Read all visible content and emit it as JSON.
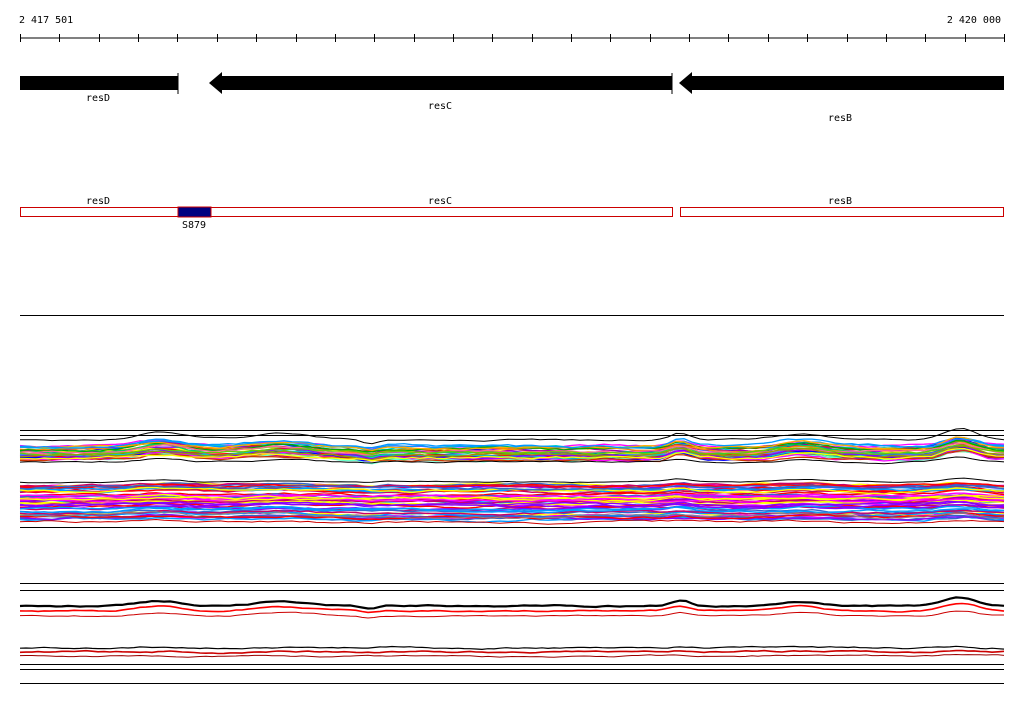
{
  "ruler": {
    "start_label": "2 417 501",
    "end_label": "2 420 000",
    "start": 2417501,
    "end": 2420000
  },
  "genes": [
    {
      "id": "resD",
      "label": "resD",
      "strand": "-"
    },
    {
      "id": "resC",
      "label": "resC",
      "strand": "-"
    },
    {
      "id": "resB",
      "label": "resB",
      "strand": "-"
    }
  ],
  "features": [
    {
      "id": "S879",
      "label": "S879",
      "color": "#000080"
    }
  ],
  "colors": {
    "arrow": "#000000",
    "gene_box_border": "#cc0000",
    "feature_fill": "#000080",
    "track_line": "#000000",
    "red_trace": "#ff0000"
  },
  "tracks": [
    {
      "id": "expression-upper-cluster",
      "type": "multi-color traces"
    },
    {
      "id": "expression-lower-cluster",
      "type": "multi-color traces"
    },
    {
      "id": "summary-upper",
      "type": "black and red traces"
    },
    {
      "id": "summary-lower",
      "type": "black and red traces"
    }
  ]
}
